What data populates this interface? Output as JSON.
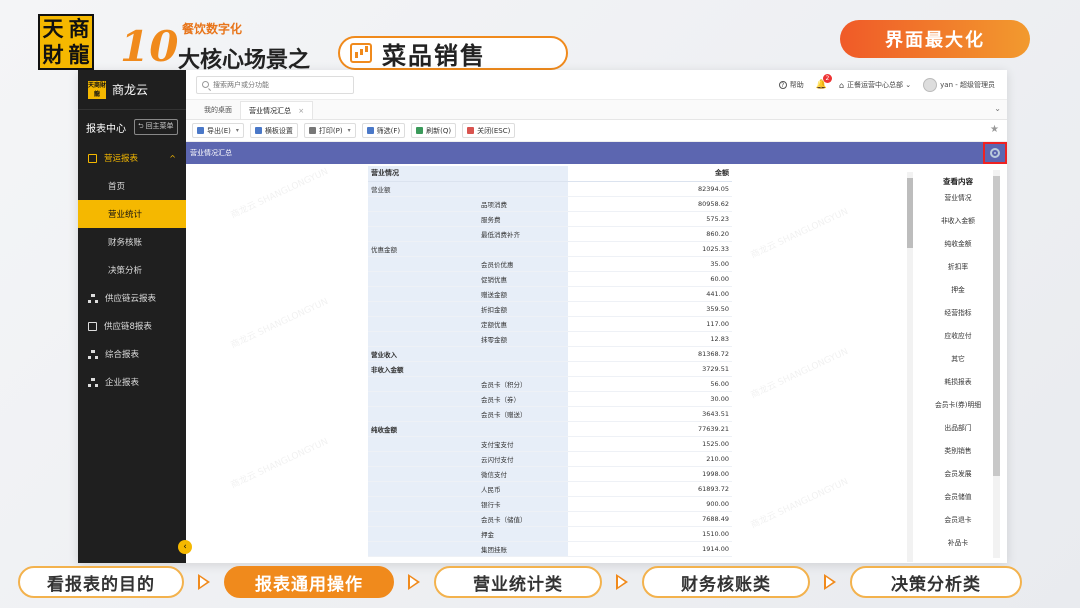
{
  "slide": {
    "logo_chars": [
      "天",
      "商",
      "財",
      "龍"
    ],
    "headline_sub": "餐饮数字化",
    "headline_num": "10",
    "headline_main": "大核心场景之",
    "headline_pill": "菜品销售",
    "maximize_label": "界面最大化"
  },
  "sidebar": {
    "brand_logo": "天商財龍",
    "brand_name": "商龙云",
    "report_center": "报表中心",
    "back_label": "回主菜单",
    "group_label": "营运报表",
    "group_caret": "^",
    "sub_items": [
      "首页",
      "营业统计",
      "财务核账",
      "决策分析"
    ],
    "active_index": 1,
    "other_items": [
      "供应链云报表",
      "供应链8报表",
      "综合报表",
      "企业报表"
    ],
    "collapse_icon": "‹"
  },
  "topbar": {
    "search_placeholder": "搜索两户或分功能",
    "help_label": "帮助",
    "help_icon": "?",
    "bell_icon": "🔔",
    "notifications": "2",
    "org_icon": "⌂",
    "org_label": "正餐运营中心总部 ⌄",
    "user_label": "yan - 超级管理员"
  },
  "tabs": [
    {
      "label": "我的桌面",
      "active": false
    },
    {
      "label": "营业情况汇总",
      "active": true
    }
  ],
  "tab_close": "×",
  "tab_dropdown": "⌄",
  "toolbar": {
    "buttons": [
      {
        "label": "导出(E)",
        "color": "#4a78c8",
        "dropdown": true
      },
      {
        "label": "横板设置",
        "color": "#4a78c8",
        "dropdown": false
      },
      {
        "label": "打印(P)",
        "color": "#777777",
        "dropdown": true
      },
      {
        "label": "筛选(F)",
        "color": "#4a78c8",
        "dropdown": false
      },
      {
        "label": "刷新(Q)",
        "color": "#3a9a5a",
        "dropdown": false
      },
      {
        "label": "关闭(ESC)",
        "color": "#d9534f",
        "dropdown": false
      }
    ],
    "dropdown_glyph": "▾",
    "star_icon": "★"
  },
  "report": {
    "header_title": "营业情况汇总",
    "columns": [
      "营业情况",
      "",
      "金额"
    ],
    "rows": [
      {
        "l1": "营业额",
        "l2": "",
        "value": "82394.05",
        "bold": false
      },
      {
        "l1": "",
        "l2": "品项消费",
        "value": "80958.62",
        "bold": false
      },
      {
        "l1": "",
        "l2": "服务费",
        "value": "575.23",
        "bold": false
      },
      {
        "l1": "",
        "l2": "最低消费补齐",
        "value": "860.20",
        "bold": false
      },
      {
        "l1": "优惠金额",
        "l2": "",
        "value": "1025.33",
        "bold": false
      },
      {
        "l1": "",
        "l2": "会员价优惠",
        "value": "35.00",
        "bold": false
      },
      {
        "l1": "",
        "l2": "促销优惠",
        "value": "60.00",
        "bold": false
      },
      {
        "l1": "",
        "l2": "赠送金额",
        "value": "441.00",
        "bold": false
      },
      {
        "l1": "",
        "l2": "折扣金额",
        "value": "359.50",
        "bold": false
      },
      {
        "l1": "",
        "l2": "定额优惠",
        "value": "117.00",
        "bold": false
      },
      {
        "l1": "",
        "l2": "抹零金额",
        "value": "12.83",
        "bold": false
      },
      {
        "l1": "营业收入",
        "l2": "",
        "value": "81368.72",
        "bold": true
      },
      {
        "l1": "非收入金额",
        "l2": "",
        "value": "3729.51",
        "bold": true
      },
      {
        "l1": "",
        "l2": "会员卡（积分）",
        "value": "56.00",
        "bold": false
      },
      {
        "l1": "",
        "l2": "会员卡（券）",
        "value": "30.00",
        "bold": false
      },
      {
        "l1": "",
        "l2": "会员卡（赠送）",
        "value": "3643.51",
        "bold": false
      },
      {
        "l1": "纯收金额",
        "l2": "",
        "value": "77639.21",
        "bold": true
      },
      {
        "l1": "",
        "l2": "支付宝支付",
        "value": "1525.00",
        "bold": false
      },
      {
        "l1": "",
        "l2": "云闪付支付",
        "value": "210.00",
        "bold": false
      },
      {
        "l1": "",
        "l2": "微信支付",
        "value": "1998.00",
        "bold": false
      },
      {
        "l1": "",
        "l2": "人民币",
        "value": "61893.72",
        "bold": false
      },
      {
        "l1": "",
        "l2": "银行卡",
        "value": "900.00",
        "bold": false
      },
      {
        "l1": "",
        "l2": "会员卡（储值）",
        "value": "7688.49",
        "bold": false
      },
      {
        "l1": "",
        "l2": "押金",
        "value": "1510.00",
        "bold": false
      },
      {
        "l1": "",
        "l2": "集团挂账",
        "value": "1914.00",
        "bold": false
      }
    ]
  },
  "right_panel": {
    "title": "查看内容",
    "items": [
      "营业情况",
      "非收入金额",
      "纯收金额",
      "折扣率",
      "押金",
      "经营指标",
      "应收应付",
      "其它",
      "耗损报表",
      "会员卡(券)明细",
      "出品部门",
      "类别销售",
      "会员发展",
      "会员储值",
      "会员退卡",
      "补品卡"
    ]
  },
  "bottom_nav": {
    "items": [
      {
        "label": "看报表的目的",
        "width": 166,
        "active": false
      },
      {
        "label": "报表通用操作",
        "width": 170,
        "active": true
      },
      {
        "label": "营业统计类",
        "width": 168,
        "active": false
      },
      {
        "label": "财务核账类",
        "width": 168,
        "active": false
      },
      {
        "label": "决策分析类",
        "width": 172,
        "active": false
      }
    ]
  },
  "watermark_text": "商龙云 SHANGLONGYUN"
}
